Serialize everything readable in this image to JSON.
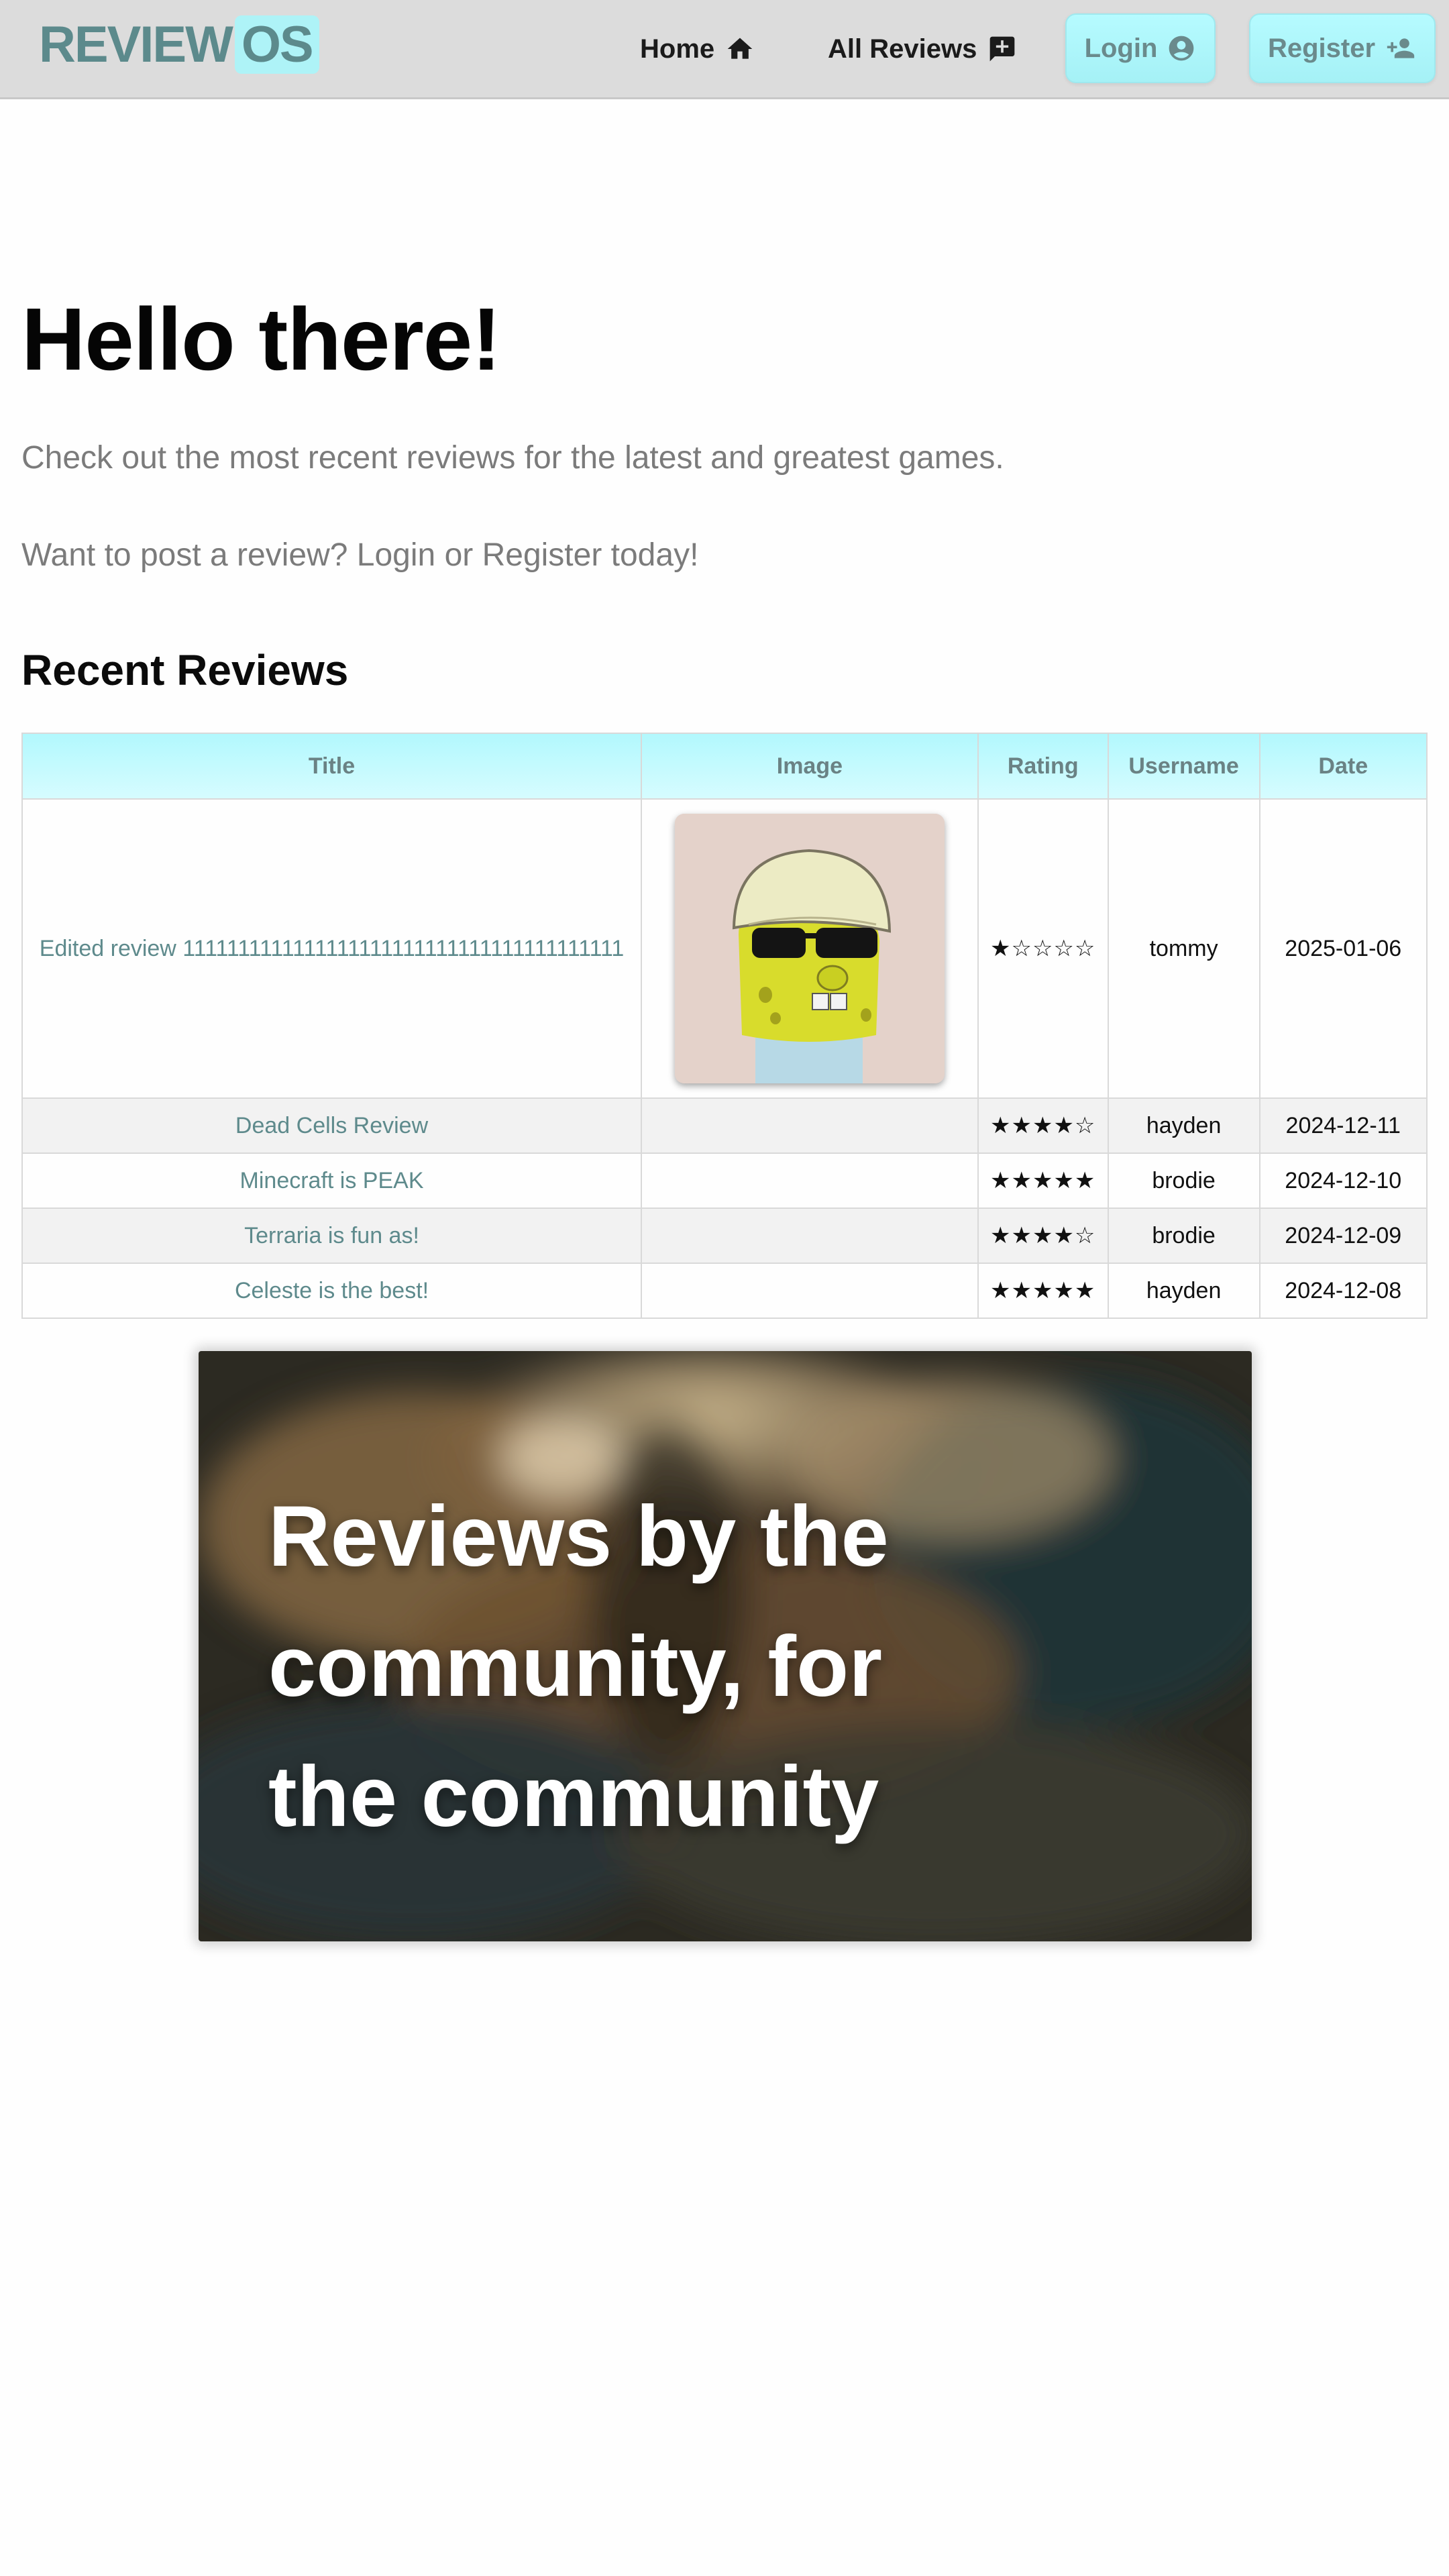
{
  "nav": {
    "logo_main": "REVIEW",
    "logo_accent": "OS",
    "home_label": "Home",
    "all_reviews_label": "All Reviews",
    "login_label": "Login",
    "register_label": "Register",
    "icons": {
      "home": "home-icon",
      "all_reviews": "add-comment-icon",
      "login": "account-circle-icon",
      "register": "person-add-icon"
    }
  },
  "hero": {
    "title": "Hello there!",
    "subtitle1": "Check out the most recent reviews for the latest and greatest games.",
    "subtitle2": "Want to post a review? Login or Register today!"
  },
  "recent": {
    "title": "Recent Reviews",
    "headers": [
      "Title",
      "Image",
      "Rating",
      "Username",
      "Date"
    ],
    "rows": [
      {
        "title": "Edited review 1111111111111111111111111111111111111111",
        "rating": "★☆☆☆☆",
        "username": "tommy",
        "date": "2025-01-06"
      },
      {
        "title": "Dead Cells Review",
        "rating": "★★★★☆",
        "username": "hayden",
        "date": "2024-12-11"
      },
      {
        "title": "Minecraft is PEAK",
        "rating": "★★★★★",
        "username": "brodie",
        "date": "2024-12-10"
      },
      {
        "title": "Terraria is fun as!",
        "rating": "★★★★☆",
        "username": "brodie",
        "date": "2024-12-09"
      },
      {
        "title": "Celeste is the best!",
        "rating": "★★★★★",
        "username": "hayden",
        "date": "2024-12-08"
      }
    ]
  },
  "banner": {
    "text": "Reviews by the community, for the community"
  },
  "colors": {
    "accent": "#aef3f7",
    "brand_text": "#5c8a8c",
    "navbar_bg": "#dcdcdc"
  }
}
